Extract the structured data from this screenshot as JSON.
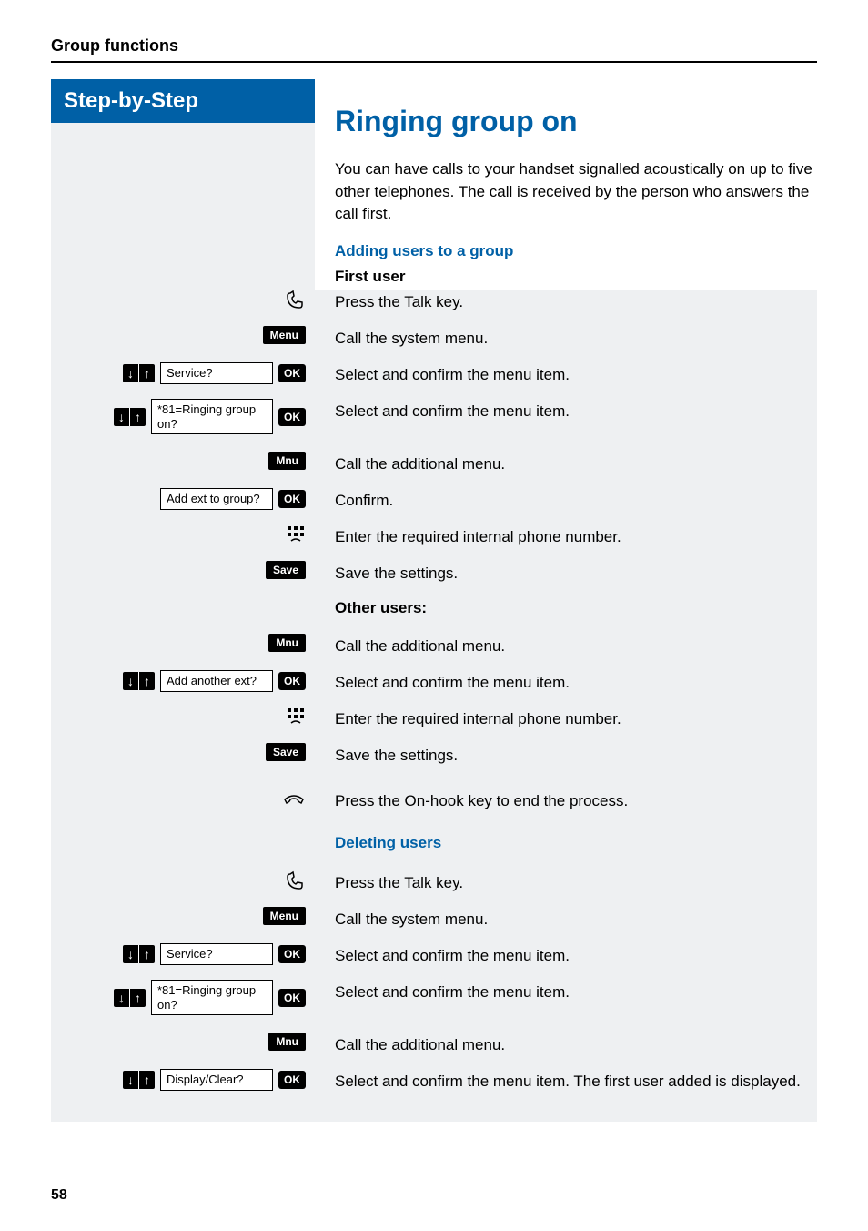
{
  "header": "Group functions",
  "banner": "Step-by-Step",
  "title": "Ringing group on",
  "intro": "You can have calls to your handset signalled acoustically on up to five other telephones. The call is received by the person who answers the call first.",
  "section1": "Adding users to a group",
  "first_user": "First user",
  "other_users": "Other users:",
  "section2": "Deleting users",
  "page_num": "58",
  "icons": {
    "menu": "Menu",
    "mnu": "Mnu",
    "ok": "OK",
    "save": "Save"
  },
  "display": {
    "service": "Service?",
    "ringing": "*81=Ringing group on?",
    "add_ext": "Add ext to group?",
    "add_another": "Add another ext?",
    "display_clear": "Display/Clear?"
  },
  "desc": {
    "press_talk": "Press the Talk key.",
    "call_system": "Call the system menu.",
    "select_confirm": "Select and confirm the menu item.",
    "call_additional": "Call the additional menu.",
    "confirm": "Confirm.",
    "enter_number": "Enter the required internal phone number.",
    "save_settings": "Save the settings.",
    "press_onhook": "Press the On-hook key to end the process.",
    "select_confirm_first": "Select and confirm the menu item. The first user added is displayed."
  }
}
